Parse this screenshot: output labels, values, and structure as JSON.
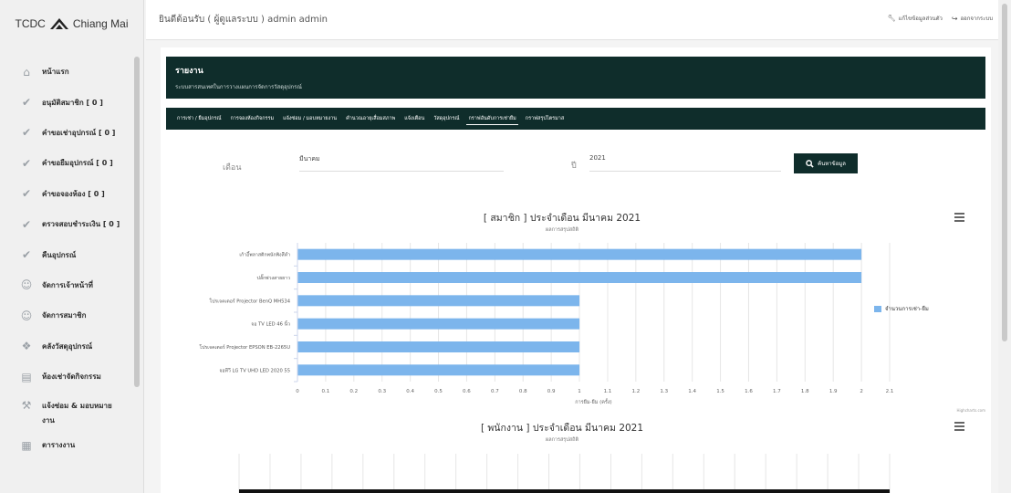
{
  "app": {
    "logo_text": "TCDC",
    "logo_city": "Chiang Mai"
  },
  "sidebar": {
    "items": [
      {
        "label": "หน้าแรก",
        "icon": "home-icon"
      },
      {
        "label": "อนุมัติสมาชิก [ 0 ]",
        "icon": "check-icon"
      },
      {
        "label": "คำขอเช่าอุปกรณ์ [ 0 ]",
        "icon": "check-icon"
      },
      {
        "label": "คำขอยืมอุปกรณ์ [ 0 ]",
        "icon": "check-icon"
      },
      {
        "label": "คำขอจองห้อง [ 0 ]",
        "icon": "check-icon"
      },
      {
        "label": "ตรวจสอบชำระเงิน [ 0 ]",
        "icon": "check-icon"
      },
      {
        "label": "คืนอุปกรณ์",
        "icon": "check-icon"
      },
      {
        "label": "จัดการเจ้าหน้าที่",
        "icon": "users-icon"
      },
      {
        "label": "จัดการสมาชิก",
        "icon": "users-icon"
      },
      {
        "label": "คลังวัสดุอุปกรณ์",
        "icon": "cubes-icon"
      },
      {
        "label": "ห้องเช่าจัดกิจกรรม",
        "icon": "room-icon"
      },
      {
        "label": "แจ้งซ่อม & มอบหมายงาน",
        "icon": "wrench-icon"
      },
      {
        "label": "ตารางงาน",
        "icon": "calendar-icon"
      }
    ]
  },
  "topbar": {
    "welcome": "ยินดีต้อนรับ ( ผู้ดูแลระบบ ) admin admin",
    "edit_profile": "แก้ไขข้อมูลส่วนตัว",
    "logout": "ออกจากระบบ"
  },
  "report": {
    "title": "รายงาน",
    "subtitle": "ระบบสารสนเทศในการวางแผนการจัดการวัสดุอุปกรณ์"
  },
  "tabs": [
    "การเช่า / ยืมอุปกรณ์",
    "การจองห้องกิจกรรม",
    "แจ้งซ่อม / มอบหมายงาน",
    "คำนวณอายุเสื่อมสภาพ",
    "แจ้งเตือน",
    "วัสดุอุปกรณ์",
    "กราฟอันดับการเช่ายืม",
    "กราฟสรุปไตรมาส"
  ],
  "active_tab_index": 6,
  "filter": {
    "month_label": "เดือน",
    "month_value": "มีนาคม",
    "year_label": "ปี",
    "year_value": "2021",
    "search_label": "ค้นหาข้อมูล"
  },
  "chart1": {
    "title": "[ สมาชิก ] ประจำเดือน มีนาคม 2021",
    "subtitle": "ผลการสรุปสถิติ"
  },
  "chart2": {
    "title": "[ พนักงาน ] ประจำเดือน มีนาคม 2021",
    "subtitle": "ผลการสรุปสถิติ"
  },
  "credit": "Highcharts.com",
  "colors": {
    "dark": "#0f2d2b",
    "bar": "#7cb5ec"
  },
  "chart_data": [
    {
      "type": "bar",
      "title": "[ สมาชิก ] ประจำเดือน มีนาคม 2021",
      "subtitle": "ผลการสรุปสถิติ",
      "categories": [
        "เก้าอี้พลาสติกพนักพิงสีดำ",
        "ปลั๊กพ่วงสายยาว",
        "โปรเจคเตอร์ Projector BenQ MH534",
        "จอ TV LED 46 นิ้ว",
        "โปรเจคเตอร์ Projector EPSON EB-2265U",
        "จอทีวี LG TV UHD LED 2020 55"
      ],
      "series": [
        {
          "name": "จำนวนการเช่า-ยืม",
          "values": [
            2,
            2,
            1,
            1,
            1,
            1
          ]
        }
      ],
      "xlabel": "การยืม-ยืม (ครั้ง)",
      "xlim": [
        0,
        2.1
      ],
      "ticks": [
        0,
        0.1,
        0.2,
        0.3,
        0.4,
        0.5,
        0.6,
        0.7,
        0.8,
        0.9,
        1,
        1.1,
        1.2,
        1.3,
        1.4,
        1.5,
        1.6,
        1.7,
        1.8,
        1.9,
        2,
        2.1
      ],
      "grid": true,
      "legend": "right"
    }
  ]
}
